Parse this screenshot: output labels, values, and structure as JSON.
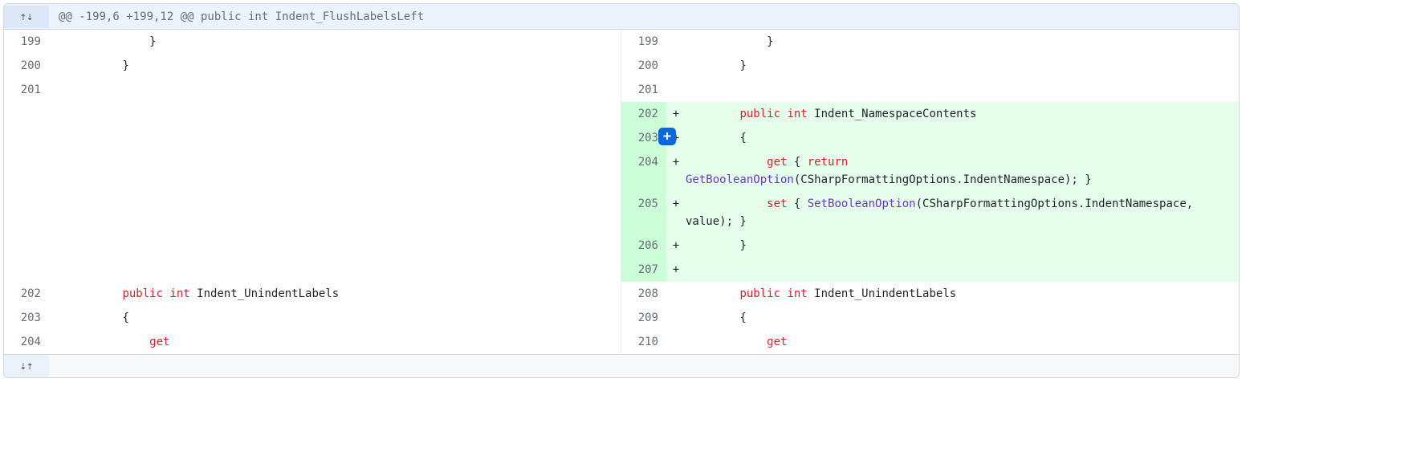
{
  "hunk": {
    "expand_up_icon": "⇡⇣",
    "header": "@@ -199,6 +199,12 @@ public int Indent_FlushLabelsLeft",
    "expand_down_icon": "⇣⇡"
  },
  "add_comment_icon": "+",
  "rows": [
    {
      "type": "ctx",
      "left": {
        "num": "199",
        "mark": "",
        "html": "            }"
      },
      "right": {
        "num": "199",
        "mark": "",
        "html": "            }"
      }
    },
    {
      "type": "ctx",
      "left": {
        "num": "200",
        "mark": "",
        "html": "        }"
      },
      "right": {
        "num": "200",
        "mark": "",
        "html": "        }"
      }
    },
    {
      "type": "ctx",
      "left": {
        "num": "201",
        "mark": "",
        "html": ""
      },
      "right": {
        "num": "201",
        "mark": "",
        "html": ""
      }
    },
    {
      "type": "add",
      "left": null,
      "right": {
        "num": "202",
        "mark": "+",
        "html": "        <span class=\"kw\">public</span> <span class=\"kw\">int</span> Indent_NamespaceContents"
      }
    },
    {
      "type": "add",
      "show_add_btn": true,
      "left": null,
      "right": {
        "num": "203",
        "mark": "+",
        "html": "        {"
      }
    },
    {
      "type": "add",
      "left": null,
      "right": {
        "num": "204",
        "mark": "+",
        "html": "            <span class=\"kw\">get</span> { <span class=\"kw\">return</span> <span class=\"fn\">GetBooleanOption</span>(CSharpFormattingOptions.IndentNamespace); }"
      }
    },
    {
      "type": "add",
      "left": null,
      "right": {
        "num": "205",
        "mark": "+",
        "html": "            <span class=\"kw\">set</span> { <span class=\"fn\">SetBooleanOption</span>(CSharpFormattingOptions.IndentNamespace, value); }"
      }
    },
    {
      "type": "add",
      "left": null,
      "right": {
        "num": "206",
        "mark": "+",
        "html": "        }"
      }
    },
    {
      "type": "add",
      "left": null,
      "right": {
        "num": "207",
        "mark": "+",
        "html": ""
      }
    },
    {
      "type": "ctx",
      "left": {
        "num": "202",
        "mark": "",
        "html": "        <span class=\"kw\">public</span> <span class=\"kw\">int</span> Indent_UnindentLabels"
      },
      "right": {
        "num": "208",
        "mark": "",
        "html": "        <span class=\"kw\">public</span> <span class=\"kw\">int</span> Indent_UnindentLabels"
      }
    },
    {
      "type": "ctx",
      "left": {
        "num": "203",
        "mark": "",
        "html": "        {"
      },
      "right": {
        "num": "209",
        "mark": "",
        "html": "        {"
      }
    },
    {
      "type": "ctx",
      "left": {
        "num": "204",
        "mark": "",
        "html": "            <span class=\"kw\">get</span>"
      },
      "right": {
        "num": "210",
        "mark": "",
        "html": "            <span class=\"kw\">get</span>"
      }
    }
  ]
}
